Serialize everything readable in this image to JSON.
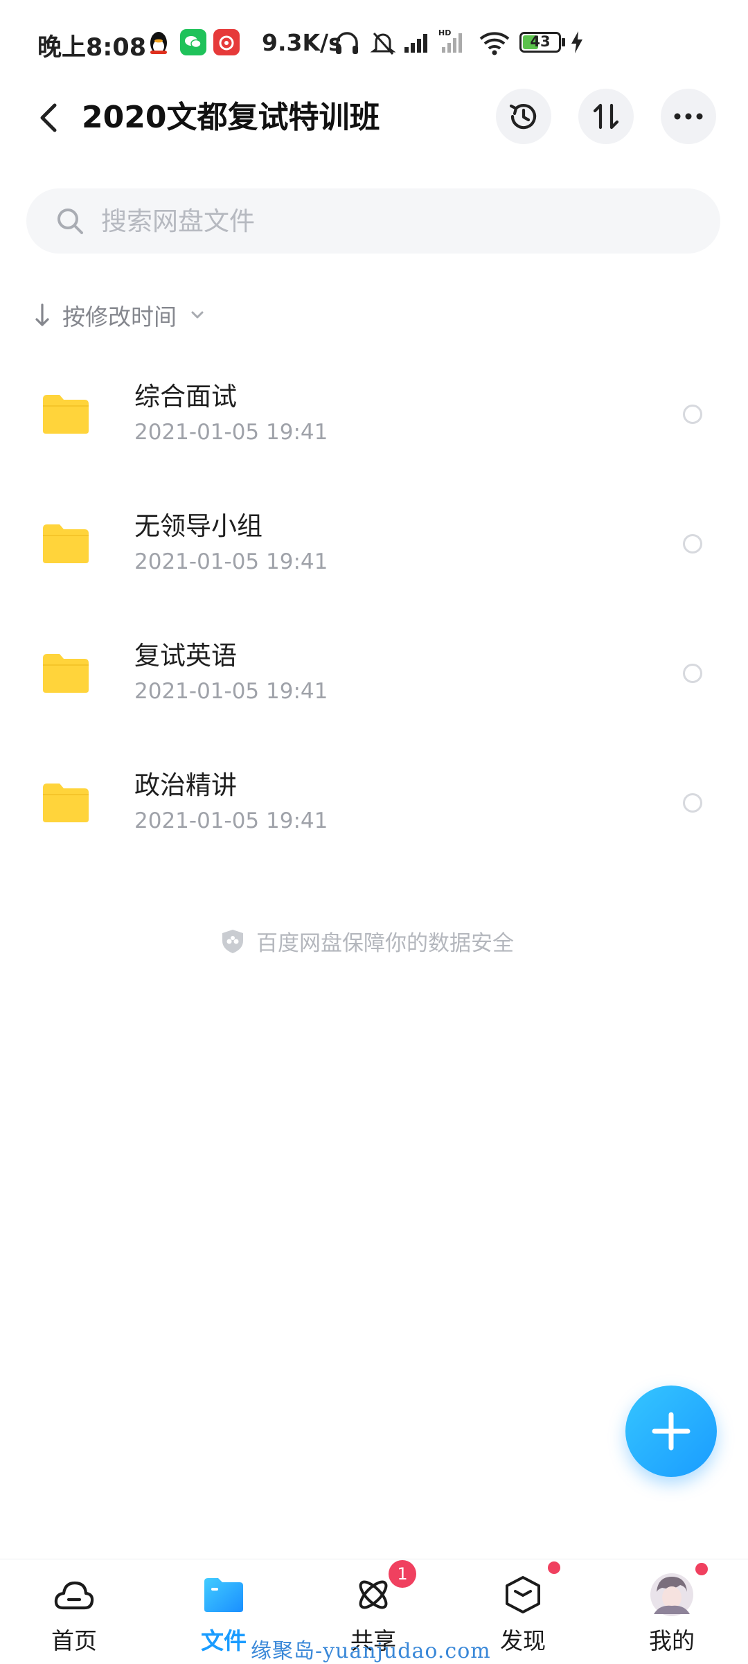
{
  "status_bar": {
    "time": "晚上8:08",
    "speed": "9.3K/s",
    "battery": "43",
    "icons": [
      "qq-icon",
      "wechat-icon",
      "netease-music-icon",
      "headphones-icon",
      "bell-off-icon",
      "signal-icon",
      "hd-signal-icon",
      "wifi-icon",
      "battery-icon",
      "charging-icon"
    ]
  },
  "header": {
    "title": "2020文都复试特训班",
    "actions": [
      "history-icon",
      "transfer-icon",
      "more-icon"
    ]
  },
  "search": {
    "placeholder": "搜索网盘文件"
  },
  "sort": {
    "label": "按修改时间"
  },
  "files": [
    {
      "name": "综合面试",
      "date": "2021-01-05  19:41"
    },
    {
      "name": "无领导小组",
      "date": "2021-01-05  19:41"
    },
    {
      "name": "复试英语",
      "date": "2021-01-05  19:41"
    },
    {
      "name": "政治精讲",
      "date": "2021-01-05  19:41"
    }
  ],
  "security_note": "百度网盘保障你的数据安全",
  "nav": {
    "home": "首页",
    "files": "文件",
    "share": "共享",
    "share_badge": "1",
    "discover": "发现",
    "me": "我的"
  },
  "watermark": "缘聚岛-yuanjudao.com",
  "colors": {
    "accent": "#1a9cff",
    "folder": "#ffd43b",
    "badge": "#f0405f"
  }
}
